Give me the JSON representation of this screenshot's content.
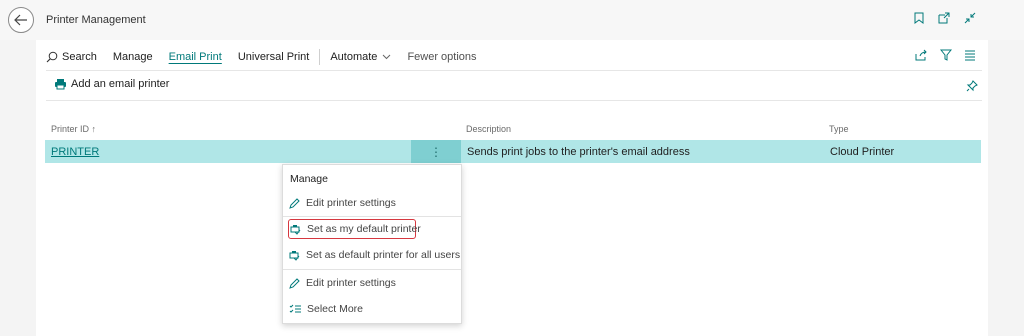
{
  "window": {
    "title": "Printer Management"
  },
  "actions": {
    "search": "Search",
    "manage": "Manage",
    "email_print": "Email Print",
    "universal_print": "Universal Print",
    "automate": "Automate",
    "fewer_options": "Fewer options",
    "add_email_printer": "Add an email printer"
  },
  "table": {
    "columns": {
      "printer_id": "Printer ID",
      "sort_arrow": "↑",
      "description": "Description",
      "type": "Type"
    },
    "rows": [
      {
        "printer_id": "PRINTER",
        "description": "Sends print jobs to the printer's email address",
        "type": "Cloud Printer"
      }
    ]
  },
  "context_menu": {
    "header": "Manage",
    "items": [
      {
        "label": "Edit printer settings",
        "icon": "pencil-icon"
      },
      {
        "label": "Set as my default printer",
        "icon": "printer-check-icon"
      },
      {
        "label": "Set as default printer for all users",
        "icon": "printer-check-icon"
      },
      {
        "label": "Edit printer settings",
        "icon": "pencil-icon"
      },
      {
        "label": "Select More",
        "icon": "list-check-icon"
      }
    ]
  },
  "colors": {
    "accent": "#00797a",
    "row_selected": "#b0e6e7",
    "row_menu": "#7fcfd1",
    "highlight_border": "#d6373f"
  }
}
